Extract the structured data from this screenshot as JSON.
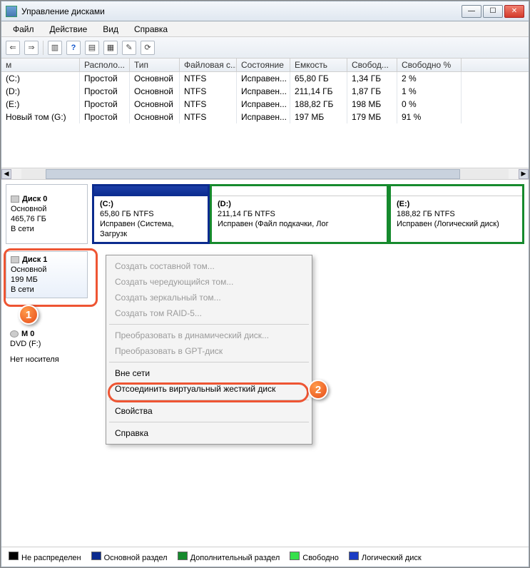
{
  "window": {
    "title": "Управление дисками"
  },
  "menu": {
    "file": "Файл",
    "action": "Действие",
    "view": "Вид",
    "help": "Справка"
  },
  "table": {
    "headers": {
      "name": "м",
      "layout": "Располо...",
      "type": "Тип",
      "fs": "Файловая с...",
      "status": "Состояние",
      "capacity": "Емкость",
      "free": "Свобод...",
      "freep": "Свободно %"
    },
    "rows": [
      {
        "name": "(C:)",
        "layout": "Простой",
        "type": "Основной",
        "fs": "NTFS",
        "status": "Исправен...",
        "capacity": "65,80 ГБ",
        "free": "1,34 ГБ",
        "freep": "2 %"
      },
      {
        "name": "(D:)",
        "layout": "Простой",
        "type": "Основной",
        "fs": "NTFS",
        "status": "Исправен...",
        "capacity": "211,14 ГБ",
        "free": "1,87 ГБ",
        "freep": "1 %"
      },
      {
        "name": "(E:)",
        "layout": "Простой",
        "type": "Основной",
        "fs": "NTFS",
        "status": "Исправен...",
        "capacity": "188,82 ГБ",
        "free": "198 МБ",
        "freep": "0 %"
      },
      {
        "name": "Новый том (G:)",
        "layout": "Простой",
        "type": "Основной",
        "fs": "NTFS",
        "status": "Исправен...",
        "capacity": "197 МБ",
        "free": "179 МБ",
        "freep": "91 %"
      }
    ]
  },
  "disks": {
    "disk0": {
      "title": "Диск 0",
      "type": "Основной",
      "size": "465,76 ГБ",
      "state": "В сети"
    },
    "disk0_parts": {
      "c": {
        "title": "(C:)",
        "line1": "65,80 ГБ NTFS",
        "line2": "Исправен (Система, Загрузк"
      },
      "d": {
        "title": "(D:)",
        "line1": "211,14 ГБ NTFS",
        "line2": "Исправен (Файл подкачки, Лог"
      },
      "e": {
        "title": "(E:)",
        "line1": "188,82 ГБ NTFS",
        "line2": "Исправен (Логический диск)"
      }
    },
    "disk1": {
      "title": "Диск 1",
      "type": "Основной",
      "size": "199 МБ",
      "state": "В сети"
    },
    "cd": {
      "title": "M 0",
      "line1": "DVD (F:)",
      "line2": "Нет носителя"
    }
  },
  "ctx": {
    "i1": "Создать составной том...",
    "i2": "Создать чередующийся том...",
    "i3": "Создать зеркальный том...",
    "i4": "Создать том RAID-5...",
    "i5": "Преобразовать в динамический диск...",
    "i6": "Преобразовать в GPT-диск",
    "i7": "Вне сети",
    "i8": "Отсоединить виртуальный жесткий диск",
    "i9": "Свойства",
    "i10": "Справка"
  },
  "legend": {
    "unalloc": "Не распределен",
    "primary": "Основной раздел",
    "ext": "Дополнительный раздел",
    "free": "Свободно",
    "logical": "Логический диск"
  },
  "badges": {
    "b1": "1",
    "b2": "2"
  }
}
